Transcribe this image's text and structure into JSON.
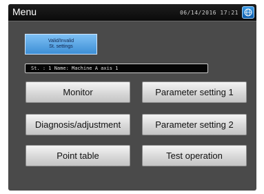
{
  "header": {
    "title": "Menu",
    "datetime": "06/14/2016 17:21",
    "globe_icon": "globe-icon"
  },
  "valid_settings": {
    "line1": "Valid/Invalid",
    "line2": "St. settings"
  },
  "station_info": "St. : 1  Name: Machine A axis 1",
  "buttons": {
    "monitor": "Monitor",
    "parameter_setting_1": "Parameter setting 1",
    "diagnosis": "Diagnosis/adjustment",
    "parameter_setting_2": "Parameter setting 2",
    "point_table": "Point table",
    "test_operation": "Test operation"
  },
  "colors": {
    "background": "#4a4a4a",
    "titlebar": "#0a0a0a",
    "accent_blue": "#3d8fd6"
  }
}
